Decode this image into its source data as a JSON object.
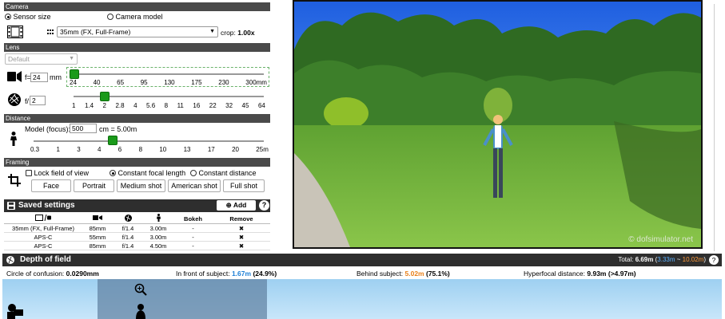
{
  "camera": {
    "header": "Camera",
    "mode_sensor": "Sensor size",
    "mode_model": "Camera model",
    "sensor_value": "35mm (FX, Full-Frame)",
    "crop_label": "crop:",
    "crop_value": "1.00x"
  },
  "lens": {
    "header": "Lens",
    "preset": "Default",
    "focal_prefix": "f=",
    "focal_value": "24",
    "focal_unit": "mm",
    "focal_ticks": [
      "24",
      "40",
      "65",
      "95",
      "130",
      "175",
      "230",
      "300mm"
    ],
    "aperture_prefix": "f/",
    "aperture_value": "2",
    "aperture_ticks": [
      "1",
      "1.4",
      "2",
      "2.8",
      "4",
      "5.6",
      "8",
      "11",
      "16",
      "22",
      "32",
      "45",
      "64"
    ]
  },
  "distance": {
    "header": "Distance",
    "label": "Model (focus):",
    "value": "500",
    "converted": "cm = 5.00m",
    "ticks": [
      "0.3",
      "1",
      "3",
      "4",
      "6",
      "8",
      "10",
      "13",
      "17",
      "20",
      "25m"
    ]
  },
  "framing": {
    "header": "Framing",
    "lock": "Lock field of view",
    "const_focal": "Constant focal length",
    "const_distance": "Constant distance",
    "buttons": [
      "Face",
      "Portrait",
      "Medium shot",
      "American shot",
      "Full shot"
    ]
  },
  "saved": {
    "title": "Saved settings",
    "add": "Add",
    "help": "?",
    "columns": [
      "Bokeh",
      "Remove"
    ],
    "rows": [
      {
        "sensor": "35mm (FX, Full-Frame)",
        "focal": "85mm",
        "aperture": "f/1.4",
        "distance": "3.00m",
        "bokeh": "-",
        "remove": "✖"
      },
      {
        "sensor": "APS-C",
        "focal": "55mm",
        "aperture": "f/1.4",
        "distance": "3.00m",
        "bokeh": "-",
        "remove": "✖"
      },
      {
        "sensor": "APS-C",
        "focal": "85mm",
        "aperture": "f/1.4",
        "distance": "4.50m",
        "bokeh": "-",
        "remove": "✖"
      }
    ]
  },
  "photo": {
    "watermark": "© dofsimulator.net"
  },
  "dof": {
    "title": "Depth of field",
    "total_label": "Total:",
    "total_value": "6.69m",
    "near": "3.33m",
    "sep": "~",
    "far": "10.02m",
    "help": "?",
    "coc_label": "Circle of confusion:",
    "coc_value": "0.0290mm",
    "front_label": "In front of subject:",
    "front_value": "1.67m",
    "front_pct": "(24.9%)",
    "behind_label": "Behind subject:",
    "behind_value": "5.02m",
    "behind_pct": "(75.1%)",
    "hyper_label": "Hyperfocal distance:",
    "hyper_value": "9.93m",
    "hyper_extra": "(>4.97m)"
  },
  "colors": {
    "accent_blue": "#1d7fd6",
    "accent_orange": "#e8801a",
    "slider_green": "#1a9a1a"
  },
  "levels": {
    "focal_slider": 0.0,
    "aperture_slider": 0.17,
    "distance_slider": 0.39
  }
}
